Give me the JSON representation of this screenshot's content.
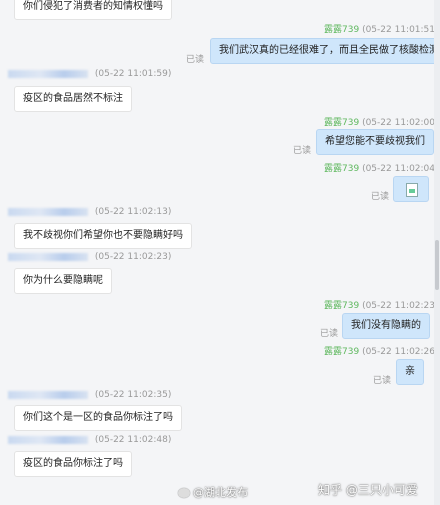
{
  "messages": [
    {
      "text": "你们侵犯了消费者的知情权懂吗"
    },
    {
      "time": "(05-22 11:01:51)",
      "name": "露露739",
      "text": "我们武汉真的已经很难了，而且全民做了核酸检测",
      "read": "已读"
    },
    {
      "time": "(05-22 11:01:59)",
      "text": "疫区的食品居然不标注"
    },
    {
      "time": "(05-22 11:02:00)",
      "name": "露露739",
      "text": "希望您能不要歧视我们",
      "read": "已读"
    },
    {
      "time": "(05-22 11:02:04)",
      "name": "露露739",
      "read": "已读"
    },
    {
      "time": "(05-22 11:02:13)",
      "text": "我不歧视你们希望你也不要隐瞒好吗"
    },
    {
      "time": "(05-22 11:02:23)",
      "text": "你为什么要隐瞒呢"
    },
    {
      "time": "(05-22 11:02:23)",
      "name": "露露739",
      "text": "我们没有隐瞒的",
      "read": "已读"
    },
    {
      "time": "(05-22 11:02:26)",
      "name": "露露739",
      "text": "亲",
      "read": "已读"
    },
    {
      "time": "(05-22 11:02:35)",
      "text": "你们这个是一区的食品你标注了吗"
    },
    {
      "time": "(05-22 11:02:48)",
      "text": "疫区的食品你标注了吗"
    }
  ],
  "watermarks": {
    "left": "@湖北发布",
    "right": "知乎 @三只小可爱"
  }
}
